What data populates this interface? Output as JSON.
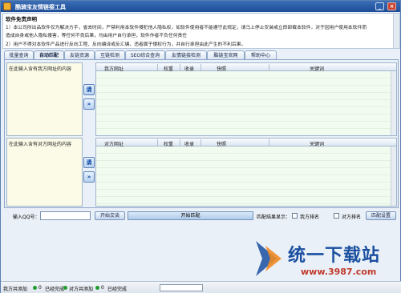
{
  "window": {
    "title": "酷骑宝友情链接工具",
    "minimize": "_",
    "close": "×"
  },
  "disclaimer": {
    "title": "软件免责声明",
    "lines": [
      "1）本公司所出品软件仅为解决方手，省去时间，严禁利用本软件侵犯他人隐私权，如软件使用者不能遵守此规定，请马上停止安装或立即卸载本软件，对于因用户使用本软件而",
      "造成自身或他人隐私侵害，等任何不良后果，均由用户自行承担，软件作者不负任何责任",
      "2）用户不得对本软件产品进行反向工程、反向编译或反汇编，违者属于侵权行为，并自行承担由此产生的不利后果。"
    ]
  },
  "tabs": [
    "批量查询",
    "自动匹配",
    "友链资源",
    "互链检测",
    "SEO综合查询",
    "友情链接检测",
    "酷链宝官网",
    "帮助中心"
  ],
  "active_tab": "自动匹配",
  "left_top": {
    "label": "在此输入含有我方网址的内容",
    "button": "请",
    "arrow": "»"
  },
  "left_bottom": {
    "label": "在此输入含有对方网址的内容",
    "button": "请",
    "arrow": "»"
  },
  "grid_top": {
    "columns": [
      "我方网址",
      "权重",
      "收录",
      "快照",
      "关键词"
    ]
  },
  "grid_bottom": {
    "columns": [
      "对方网址",
      "权重",
      "收录",
      "快照",
      "关键词"
    ]
  },
  "controls": {
    "qq_label": "输入QQ号：",
    "qq_value": "",
    "start_exchange": "开始交谈",
    "start_match": "开始匹配",
    "result_label": "匹配结果显示：",
    "opt_ours": "我方排名",
    "opt_theirs": "对方排名",
    "match_settings": "匹配设置"
  },
  "watermark": {
    "text": "统一下载站",
    "url": "www.3987.com"
  },
  "status": {
    "ours_added_label": "我方共添加",
    "ours_added_count": "0",
    "ours_done_label": "已经完成",
    "theirs_added_label": "对方共添加",
    "theirs_added_count": "0",
    "theirs_done_label": "已经完成"
  },
  "colors": {
    "title_bar": "#1d4c96",
    "watermark_blue": "#1a4fa0",
    "status_green": "#1f9d2f"
  }
}
